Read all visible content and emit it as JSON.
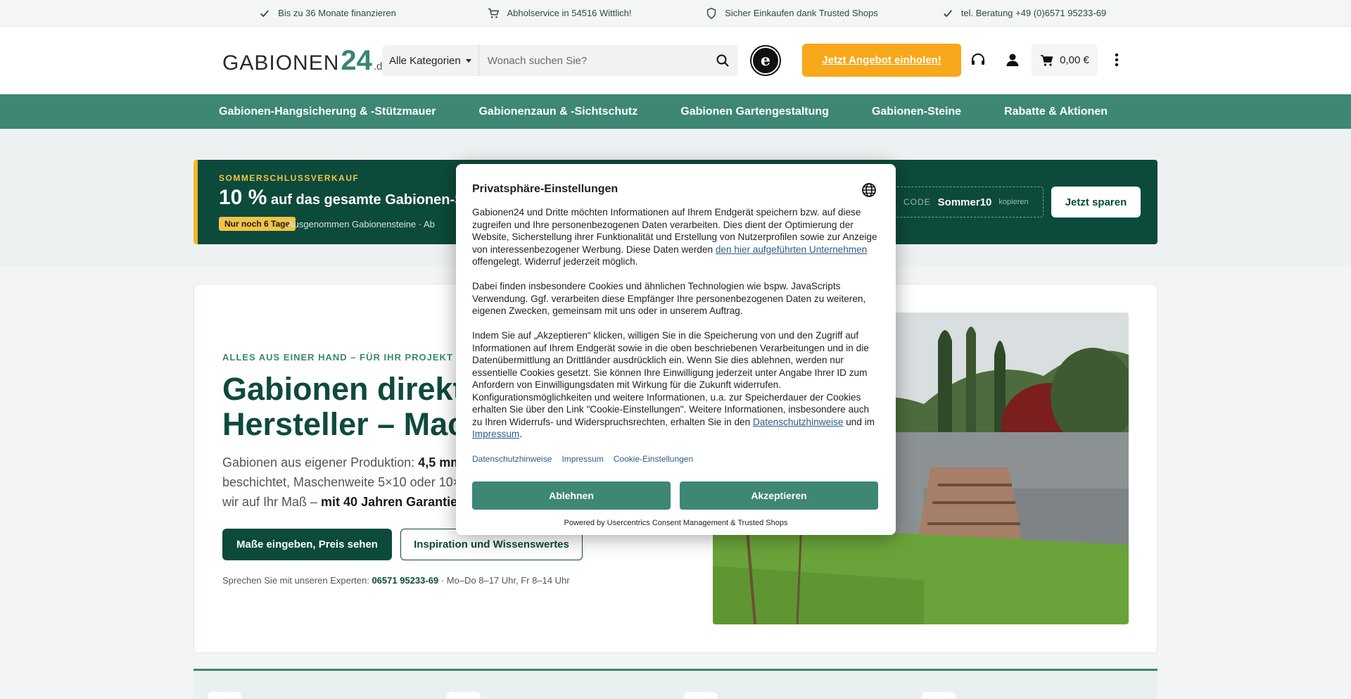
{
  "topbar": {
    "items": [
      {
        "icon": "check-icon",
        "text": "Bis zu 36 Monate finanzieren"
      },
      {
        "icon": "cart-icon",
        "text": "Abholservice in 54516 Wittlich!"
      },
      {
        "icon": "shield-icon",
        "text": "Sicher Einkaufen dank Trusted Shops"
      },
      {
        "icon": "check-icon",
        "text": "tel. Beratung +49 (0)6571 95233-69"
      }
    ]
  },
  "header": {
    "logo_part1": "GABIONEN",
    "logo_part2": "24",
    "logo_part3": ".de",
    "search_category": "Alle Kategorien",
    "search_placeholder": "Wonach suchen Sie?",
    "trust_letter": "e",
    "offer_button": "Jetzt Angebot einholen!",
    "cart_total": "0,00 €"
  },
  "nav": {
    "items": [
      "Gabionen-Hangsicherung & -Stützmauer",
      "Gabionenzaun & -Sichtschutz",
      "Gabionen Gartengestaltung",
      "Gabionen-Steine",
      "Rabatte & Aktionen"
    ]
  },
  "promo": {
    "kicker": "SOMMERSCHLUSSVERKAUF",
    "headline_big": "10 %",
    "headline_rest": "auf das gesamte Gabionen-So",
    "badge": "Nur noch 6 Tage",
    "sub": "Ausgenommen Gabionensteine · Ab",
    "code_label": "CODE",
    "code_value": "Sommer10",
    "code_copy": "kopieren",
    "save_button": "Jetzt sparen"
  },
  "hero": {
    "kicker": "ALLES AUS EINER HAND – FÜR IHR PROJEKT",
    "title_line1": "Gabionen direkt",
    "title_line2": "Hersteller – Mac",
    "desc_a": "Gabionen aus eigener Produktion: ",
    "desc_b": "4,5 mm",
    "desc_c": "beschichtet, Maschenweite 5×10 oder 10×",
    "desc_d": "wir auf Ihr Maß – ",
    "desc_e": "mit 40 Jahren Garantie",
    "button_primary": "Maße eingeben, Preis sehen",
    "button_secondary": "Inspiration und Wissenswertes",
    "expert_prefix": "Sprechen Sie mit unseren Experten: ",
    "expert_phone": "06571 95233-69",
    "expert_hours": " · Mo–Do 8–17 Uhr, Fr 8–14 Uhr"
  },
  "consent": {
    "title": "Privatsphäre-Einstellungen",
    "p1a": "Gabionen24 und Dritte möchten Informationen auf Ihrem Endgerät speichern bzw. auf diese zugreifen und Ihre personenbezogenen Daten verarbeiten. Dies dient der Optimierung der Website, Sicherstellung ihrer Funktionalität und Erstellung von Nutzerprofilen sowie zur Anzeige von interessenbezogener Werbung. Diese Daten werden ",
    "p1_link": "den hier aufgeführten Unternehmen",
    "p1b": " offengelegt. Widerruf jederzeit möglich.",
    "p2": "Dabei finden insbesondere Cookies und ähnlichen Technologien wie bspw. JavaScripts Verwendung. Ggf. verarbeiten diese Empfänger Ihre personenbezogenen Daten zu weiteren, eigenen Zwecken, gemeinsam mit uns oder in unserem Auftrag.",
    "p3a": "Indem Sie auf „Akzeptieren“ klicken, willigen Sie in die Speicherung von und den Zugriff auf Informationen auf Ihrem Endgerät sowie in die oben beschriebenen Verarbeitungen und in die Datenübermittlung an Drittländer ausdrücklich ein. Wenn Sie dies ablehnen, werden nur essentielle Cookies gesetzt. Sie können Ihre Einwilligung jederzeit unter Angabe Ihrer ID zum Anfordern von Einwilligungsdaten mit Wirkung für die Zukunft widerrufen. Konfigurationsmöglichkeiten und weitere Informationen, u.a. zur Speicherdauer der Cookies erhalten Sie über den Link \"Cookie-Einstellungen\". Weitere Informationen, insbesondere auch zu Ihren Widerrufs- und Widerspruchsrechten, erhalten Sie in den ",
    "p3_link1": "Datenschutzhinweise",
    "p3_mid": " und im ",
    "p3_link2": "Impressum",
    "p3_end": ".",
    "links": [
      "Datenschutzhinweise",
      "Impressum",
      "Cookie-Einstellungen"
    ],
    "decline": "Ablehnen",
    "accept": "Akzeptieren",
    "powered": "Powered by Usercentrics Consent Management & Trusted Shops"
  },
  "colors": {
    "brand_green": "#3d8774",
    "dark_green": "#0c4a3b",
    "accent_orange": "#f8a81b",
    "promo_yellow": "#f2c347"
  }
}
